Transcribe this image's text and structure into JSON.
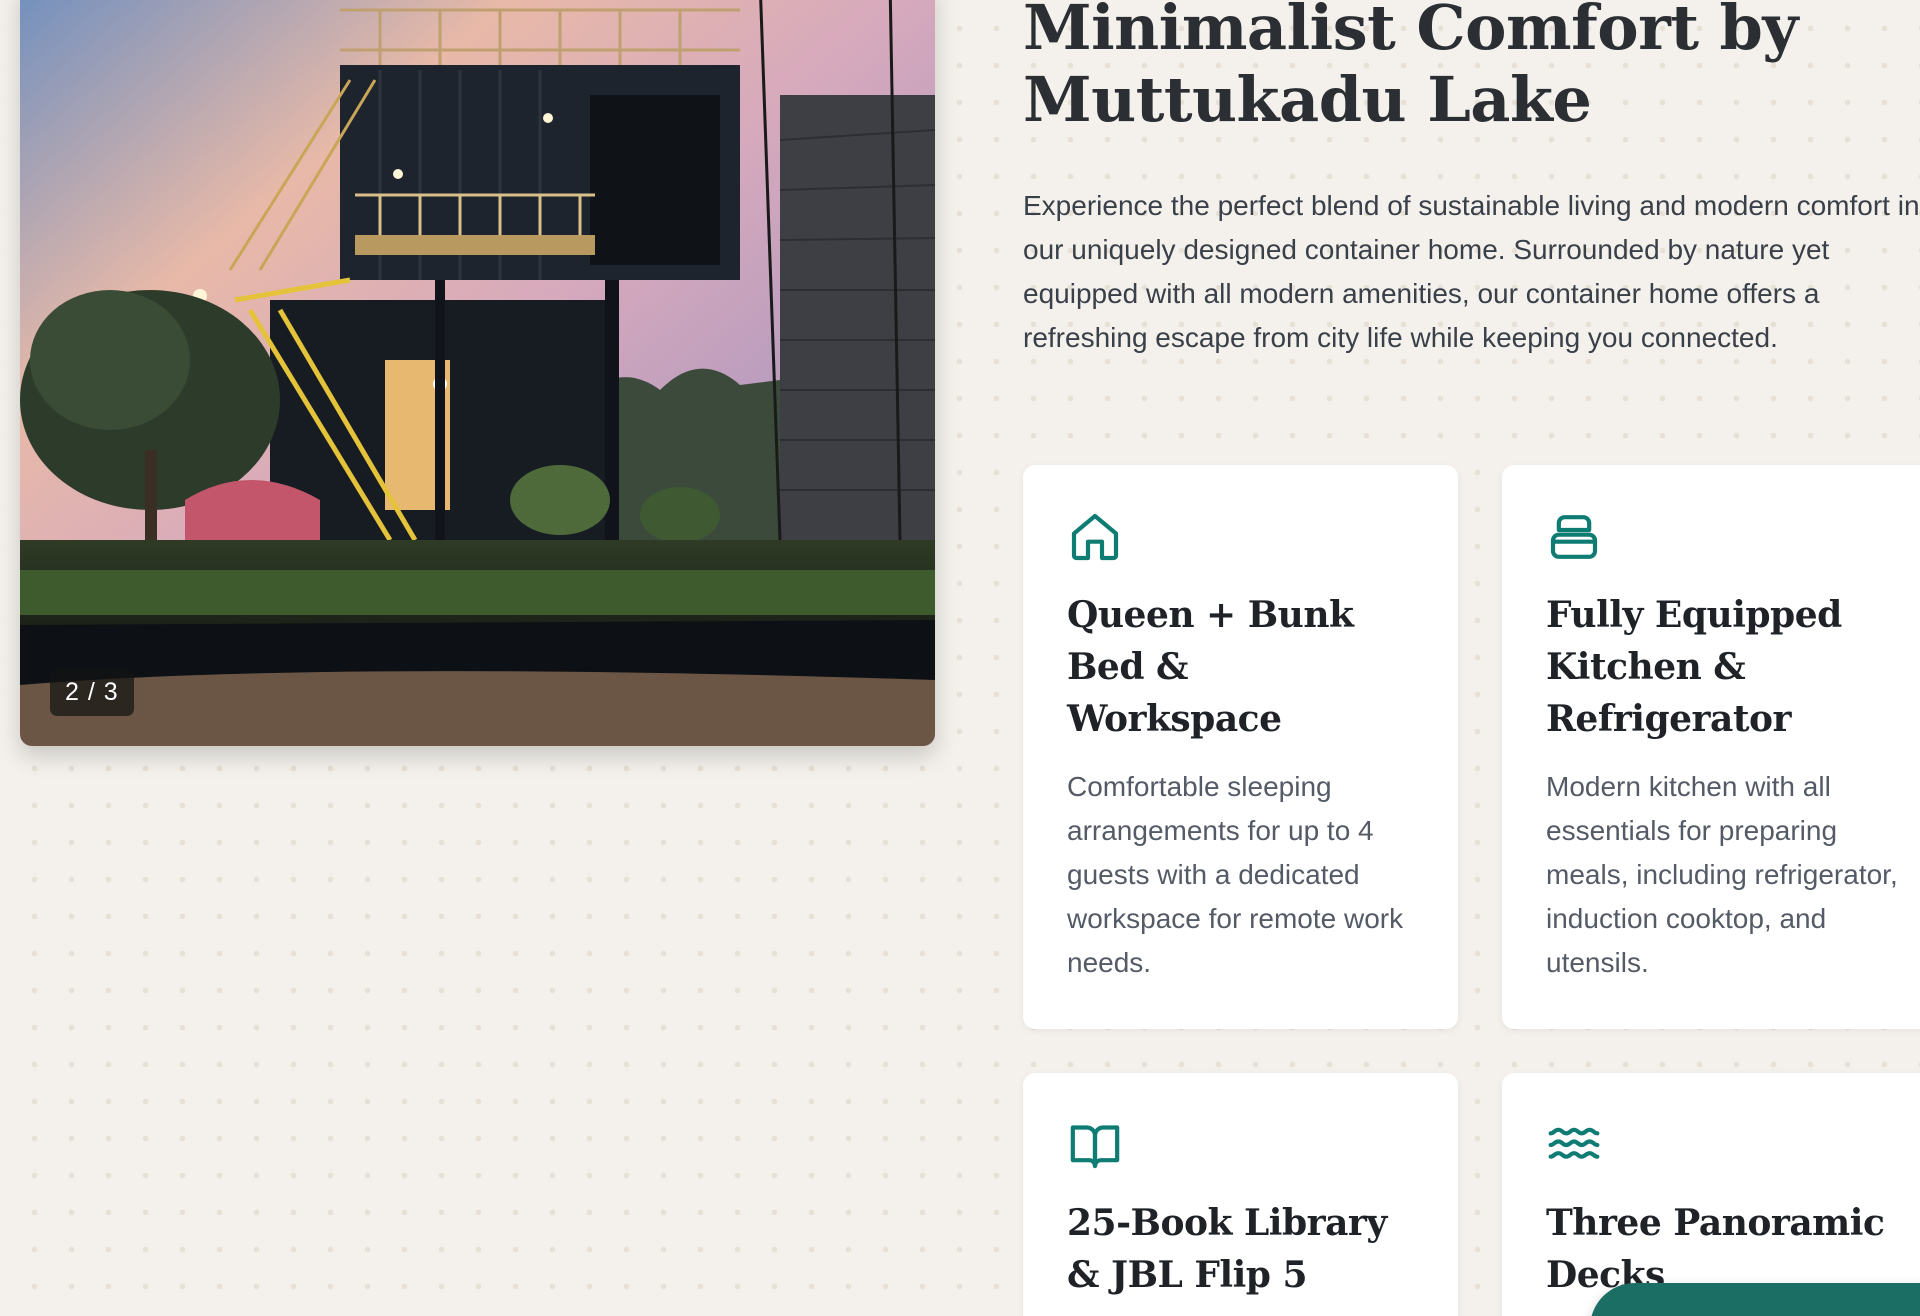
{
  "gallery": {
    "counter": "2 / 3",
    "photo": "container-home-exterior-dusk"
  },
  "heading": {
    "title": "Minimalist Comfort by Muttukadu Lake"
  },
  "intro": {
    "text": "Experience the perfect blend of sustainable living and modern comfort in our uniquely designed container home. Surrounded by nature yet equipped with all modern amenities, our container home offers a refreshing escape from city life while keeping you connected."
  },
  "features": [
    {
      "icon": "house-icon",
      "title": "Queen + Bunk Bed & Workspace",
      "description": "Comfortable sleeping arrangements for up to 4 guests with a dedicated workspace for remote work needs."
    },
    {
      "icon": "cooking-pot-icon",
      "title": "Fully Equipped Kitchen & Refrigerator",
      "description": "Modern kitchen with all essentials for preparing meals, including refrigerator, induction cooktop, and utensils."
    },
    {
      "icon": "open-book-icon",
      "title": "25-Book Library & JBL Flip 5",
      "description": ""
    },
    {
      "icon": "waves-icon",
      "title": "Three Panoramic Decks",
      "description": ""
    }
  ],
  "colors": {
    "background": "#f4f1ec",
    "accent": "#0f7c74",
    "heading": "#1f2328",
    "fab": "#1a6e64"
  }
}
